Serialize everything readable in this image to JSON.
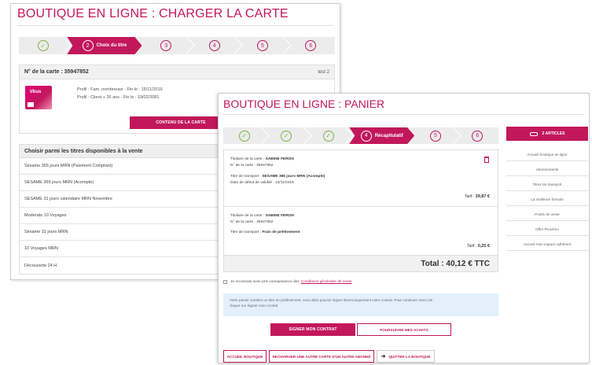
{
  "charger": {
    "title": "BOUTIQUE EN LIGNE : CHARGER LA CARTE",
    "steps": {
      "step1": "✓",
      "step2_num": "2",
      "step2_label": "Choix du titre",
      "step3": "3",
      "step4": "4",
      "step5": "5",
      "step6": "6"
    },
    "card": {
      "number": "N° de la carte : 35947852",
      "test": "test 2",
      "logo_text": "t/bus",
      "profile1": "Profil : Fam. nombreuse - Fin le : 15/11/2016",
      "profile2": "Profil : Client + 26 ans - Fin le : 19/02/2081",
      "button": "CONTENU DE LA CARTE"
    },
    "list": {
      "heading": "Choisir parmi les titres disponibles à la vente",
      "items": [
        "Sésame 365 jours MRN (Paiement Comptant)",
        "SESAME 365 jours MRN (Acompte)",
        "SESAME 31 jours calendaire MRN Novembre",
        "Moderato 10 Voyages",
        "Sésame 31 jours MRN",
        "10 Voyages MRN",
        "Découverte 24 H"
      ]
    }
  },
  "panier": {
    "title": "BOUTIQUE EN LIGNE : PANIER",
    "steps": {
      "step1": "✓",
      "step2": "✓",
      "step3": "✓",
      "step4_num": "4",
      "step4_label": "Récapitulatif",
      "step5": "5",
      "step6": "6"
    },
    "cart_button": "2 ARTICLES",
    "menu": [
      "Accueil boutique en ligne",
      "Abonnements",
      "Titres de transport",
      "La meilleure formule",
      "Points de vente",
      "Offre Proxémo",
      "Accueil mon espace adhérent"
    ],
    "item1": {
      "holder_label": "Titulaire de la carte :",
      "holder": "SABINE FERON",
      "card_label": "N° de la carte :",
      "card": "35947852",
      "title_label": "Titre de transport :",
      "title": "SESAME 365 jours MRN (Acompte)",
      "date_label": "Date de début de validité :",
      "date": "10/11/2016",
      "tarif_label": "Tarif :",
      "tarif": "39,87 €"
    },
    "item2": {
      "holder_label": "Titulaire de la carte :",
      "holder": "SABINE FERON",
      "card_label": "N° de la carte :",
      "card": "35947852",
      "title_label": "Titre de transport :",
      "title": "Frais de prélèvement",
      "tarif_label": "Tarif :",
      "tarif": "0,25 €"
    },
    "total": "Total : 40,12 € TTC",
    "cgv_text": "Je reconnais avoir pris connaissance des",
    "cgv_link": "Conditions générales de vente",
    "info_line1": "Votre panier contient un titre en prélèvement, vous allez pouvoir signer électroniquement votre contrat. Pour continuer merci de",
    "info_line2": "cliquer sur Signer mon contrat",
    "sign_button": "SIGNER MON CONTRAT",
    "continue_button": "POURSUIVRE MES ACHATS",
    "home_button": "ACCUEIL BOUTIQUE",
    "reload_button": "RECHARGER UNE AUTRE CARTE D'UN AUTRE ABONNÉ",
    "quit_button": "QUITTER LA BOUTIQUE"
  }
}
